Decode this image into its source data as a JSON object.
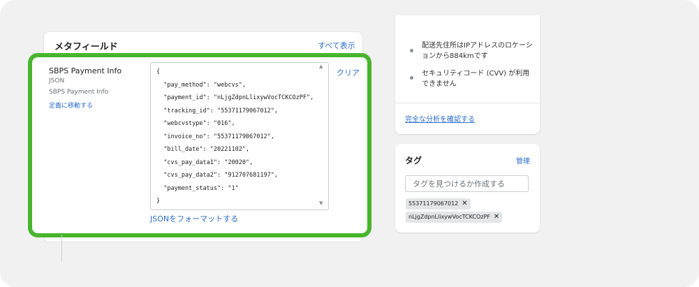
{
  "metafields": {
    "title": "メタフィールド",
    "show_all": "すべて表示",
    "field": {
      "name": "SBPS Payment Info",
      "type": "JSON",
      "key_label": "SBPS Payment Info",
      "go_to_definition": "定義に移動する"
    },
    "json_lines": [
      "{",
      "  \"pay_method\": \"webcvs\",",
      "  \"payment_id\": \"nLjgZdpnLlixywVocTCKCOzPF\",",
      "  \"tracking_id\": \"55371179067012\",",
      "  \"webcvstype\": \"016\",",
      "  \"invoice_no\": \"55371179067012\",",
      "  \"bill_date\": \"20221102\",",
      "  \"cvs_pay_data1\": \"20020\",",
      "  \"cvs_pay_data2\": \"912707681197\",",
      "  \"payment_status\": \"1\"",
      "}"
    ],
    "clear_label": "クリア",
    "format_json_label": "JSONをフォーマットする"
  },
  "analysis": {
    "risk_items": [
      "配送先住所はIPアドレスのロケーションから884kmです",
      "セキュリティコード (CVV) が利用できません"
    ],
    "full_analysis_link": "完全な分析を確認する"
  },
  "tags": {
    "title": "タグ",
    "manage_label": "管理",
    "input_placeholder": "タグを見つけるか作成する",
    "chips": [
      "55371179067012",
      "nLjgZdpnLlixywVocTCKCOzPF"
    ],
    "remove_symbol": "✕"
  },
  "colors": {
    "highlight_border": "#47b52c",
    "link": "#2c6ecb",
    "background": "#f1f1f1"
  }
}
